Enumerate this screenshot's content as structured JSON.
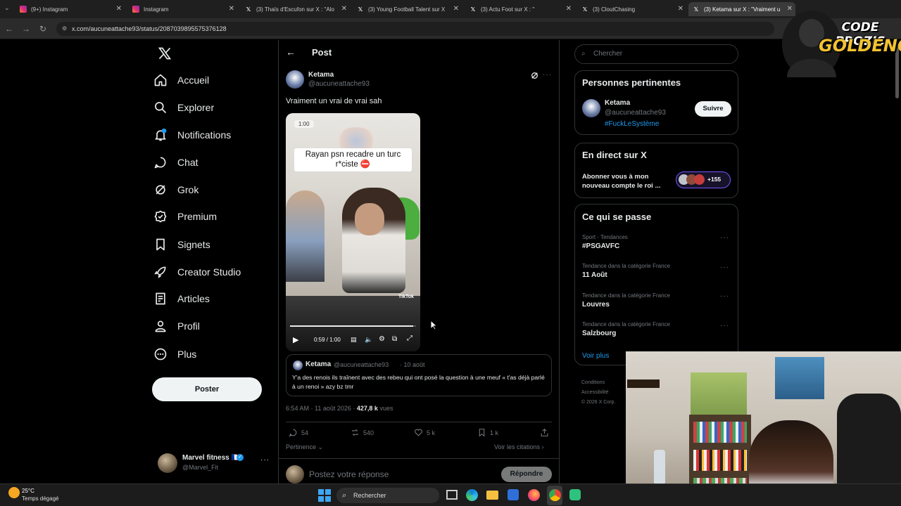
{
  "browser": {
    "tabs": [
      {
        "title": "(9+) Instagram",
        "icon": "instagram-icon"
      },
      {
        "title": "Instagram",
        "icon": "instagram-icon"
      },
      {
        "title": "(3) Thaïs d'Escufon sur X : \"Alo",
        "icon": "x-icon"
      },
      {
        "title": "(3) Young Football Talent sur X",
        "icon": "x-icon"
      },
      {
        "title": "(3) Actu Foot sur X : \"",
        "icon": "x-icon"
      },
      {
        "title": "(3) CloutChasing",
        "icon": "x-icon"
      },
      {
        "title": "(3) Ketama sur X : \"Vraiment u",
        "icon": "x-icon",
        "active": true
      }
    ],
    "url": "x.com/aucuneattache93/status/2087039895575376128"
  },
  "sidebar": {
    "items": [
      {
        "label": "Accueil",
        "icon": "home-icon"
      },
      {
        "label": "Explorer",
        "icon": "search-icon"
      },
      {
        "label": "Notifications",
        "icon": "bell-icon"
      },
      {
        "label": "Chat",
        "icon": "chat-icon"
      },
      {
        "label": "Grok",
        "icon": "grok-icon"
      },
      {
        "label": "Premium",
        "icon": "premium-icon"
      },
      {
        "label": "Signets",
        "icon": "bookmark-icon"
      },
      {
        "label": "Creator Studio",
        "icon": "rocket-icon"
      },
      {
        "label": "Articles",
        "icon": "article-icon"
      },
      {
        "label": "Profil",
        "icon": "profile-icon"
      },
      {
        "label": "Plus",
        "icon": "more-icon"
      }
    ],
    "post_button": "Poster",
    "account": {
      "name": "Marvel fitness 🇫🇷",
      "handle": "@Marvel_Fit"
    }
  },
  "post": {
    "header_title": "Post",
    "author_name": "Ketama",
    "author_handle": "@aucuneattache93",
    "text": "Vraiment un vrai de vrai sah",
    "video": {
      "duration_badge": "1:00",
      "caption_line1": "Rayan psn recadre un turc",
      "caption_line2": "r*ciste ⛔",
      "time": "0:59 / 1:00",
      "progress": 0.98,
      "watermark": "TikTok"
    },
    "quote": {
      "author_name": "Ketama",
      "author_handle": "@aucuneattache93",
      "date": "· 10 août",
      "text": "Y'a des renois ils traînent avec des rebeu qui ont posé la question à une meuf « t'as déjà parlé à un renoi » azy bz tmr"
    },
    "meta_time": "6:54 AM · 11 août 2026 · ",
    "meta_views_value": "427,8 k",
    "meta_views_label": " vues",
    "stats": {
      "replies": "54",
      "reposts": "540",
      "likes": "5 k",
      "bookmarks": "1 k"
    },
    "sort_label": "Pertinence",
    "quotes_link": "Voir les citations",
    "reply_placeholder": "Postez votre réponse",
    "reply_button": "Répondre"
  },
  "right": {
    "search_placeholder": "Chercher",
    "relevant": {
      "title": "Personnes pertinentes",
      "name": "Ketama",
      "handle": "@aucuneattache93",
      "bio": "#FuckLeSystème",
      "follow": "Suivre"
    },
    "live": {
      "title": "En direct sur X",
      "text_line1": "Abonner vous à mon",
      "text_line2": "nouveau compte le roi ...",
      "count": "+155"
    },
    "trends": {
      "title": "Ce qui se passe",
      "items": [
        {
          "category": "Sport · Tendances",
          "name": "#PSGAVFC"
        },
        {
          "category": "Tendance dans la catégorie France",
          "name": "11 Août"
        },
        {
          "category": "Tendance dans la catégorie France",
          "name": "Louvres"
        },
        {
          "category": "Tendance dans la catégorie France",
          "name": "Salzbourg"
        }
      ],
      "more": "Voir plus"
    },
    "footer": {
      "line1": "Conditions",
      "line2": "Accessibilité",
      "line3": "© 2026 X Corp."
    }
  },
  "overlay": {
    "logo_line1": "CODE PROZIS",
    "logo_line2": "GOLDENG"
  },
  "taskbar": {
    "temp": "25°C",
    "weather": "Temps dégagé",
    "search": "Rechercher"
  },
  "colors": {
    "accent": "#1d9bf0",
    "background": "#000000",
    "border": "#2f3336",
    "text": "#e7e9ea",
    "muted": "#71767b"
  }
}
